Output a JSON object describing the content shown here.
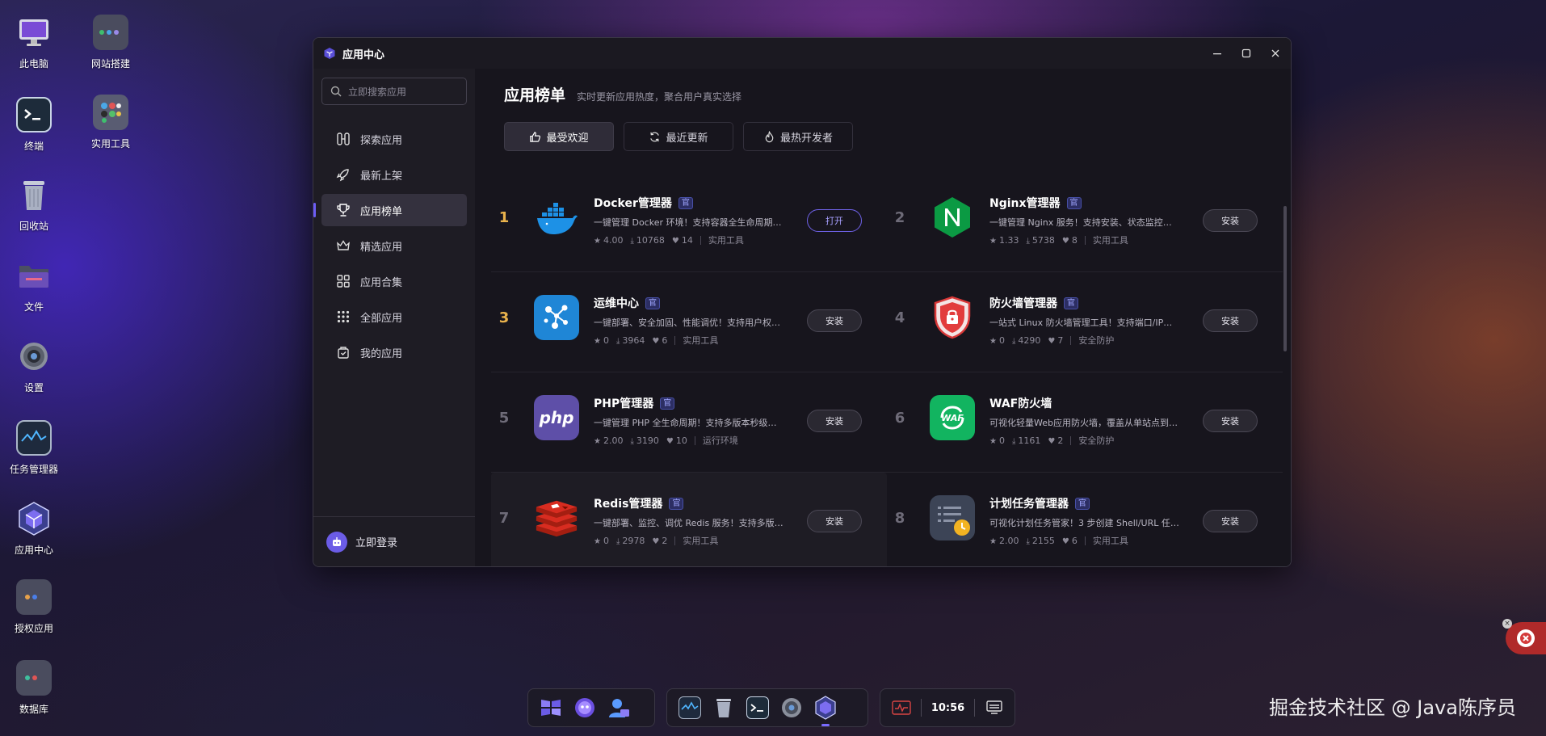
{
  "desktop": [
    {
      "label": "此电脑",
      "icon": "monitor-icon"
    },
    {
      "label": "网站搭建",
      "icon": "folder-grid-icon"
    },
    {
      "label": "终端",
      "icon": "terminal-icon"
    },
    {
      "label": "实用工具",
      "icon": "folder-grid-icon"
    },
    {
      "label": "回收站",
      "icon": "trash-icon"
    },
    {
      "label": "文件",
      "icon": "folder-icon"
    },
    {
      "label": "设置",
      "icon": "gear-icon"
    },
    {
      "label": "任务管理器",
      "icon": "activity-icon"
    },
    {
      "label": "应用中心",
      "icon": "app-center-icon"
    },
    {
      "label": "授权应用",
      "icon": "folder-grid-icon"
    },
    {
      "label": "数据库",
      "icon": "folder-grid-icon"
    }
  ],
  "window": {
    "title": "应用中心",
    "controls": [
      "minimize",
      "maximize",
      "close"
    ]
  },
  "sidebar": {
    "search_placeholder": "立即搜索应用",
    "items": [
      {
        "label": "探索应用",
        "icon": "explore-icon"
      },
      {
        "label": "最新上架",
        "icon": "rocket-icon"
      },
      {
        "label": "应用榜单",
        "icon": "trophy-icon",
        "active": true
      },
      {
        "label": "精选应用",
        "icon": "crown-icon"
      },
      {
        "label": "应用合集",
        "icon": "grid-icon"
      },
      {
        "label": "全部应用",
        "icon": "dots-grid-icon"
      },
      {
        "label": "我的应用",
        "icon": "bag-icon"
      }
    ],
    "login_label": "立即登录"
  },
  "main": {
    "title": "应用榜单",
    "subtitle": "实时更新应用热度，聚合用户真实选择",
    "tabs": [
      {
        "label": "最受欢迎",
        "icon": "thumbs-up-icon",
        "active": true
      },
      {
        "label": "最近更新",
        "icon": "refresh-icon"
      },
      {
        "label": "最热开发者",
        "icon": "flame-icon"
      }
    ],
    "official_badge": "官",
    "apps": [
      {
        "rank": "1",
        "name": "Docker管理器",
        "desc": "一键管理 Docker 环境！支持容器全生命周期…",
        "rating": "4.00",
        "downloads": "10768",
        "likes": "14",
        "category": "实用工具",
        "action": "打开",
        "icon": "docker-icon"
      },
      {
        "rank": "2",
        "name": "Nginx管理器",
        "desc": "一键管理 Nginx 服务！支持安装、状态监控…",
        "rating": "1.33",
        "downloads": "5738",
        "likes": "8",
        "category": "实用工具",
        "action": "安装",
        "icon": "nginx-icon"
      },
      {
        "rank": "3",
        "name": "运维中心",
        "desc": "一键部署、安全加固、性能调优！支持用户权…",
        "rating": "0",
        "downloads": "3964",
        "likes": "6",
        "category": "实用工具",
        "action": "安装",
        "icon": "ops-icon"
      },
      {
        "rank": "4",
        "name": "防火墙管理器",
        "desc": "一站式 Linux 防火墙管理工具！支持端口/IP…",
        "rating": "0",
        "downloads": "4290",
        "likes": "7",
        "category": "安全防护",
        "action": "安装",
        "icon": "shield-lock-icon"
      },
      {
        "rank": "5",
        "name": "PHP管理器",
        "desc": "一键管理 PHP 全生命周期！支持多版本秒级…",
        "rating": "2.00",
        "downloads": "3190",
        "likes": "10",
        "category": "运行环境",
        "action": "安装",
        "icon": "php-icon"
      },
      {
        "rank": "6",
        "name": "WAF防火墙",
        "desc": "可视化轻量Web应用防火墙，覆盖从单站点到…",
        "rating": "0",
        "downloads": "1161",
        "likes": "2",
        "category": "安全防护",
        "action": "安装",
        "icon": "waf-icon"
      },
      {
        "rank": "7",
        "name": "Redis管理器",
        "desc": "一键部署、监控、调优 Redis 服务！支持多版…",
        "rating": "0",
        "downloads": "2978",
        "likes": "2",
        "category": "实用工具",
        "action": "安装",
        "icon": "redis-icon"
      },
      {
        "rank": "8",
        "name": "计划任务管理器",
        "desc": "可视化计划任务管家！3 步创建 Shell/URL 任…",
        "rating": "2.00",
        "downloads": "2155",
        "likes": "6",
        "category": "实用工具",
        "action": "安装",
        "icon": "cron-icon"
      }
    ]
  },
  "taskbar": {
    "clock": "10:56"
  },
  "watermark": "掘金技术社区 @ Java陈序员",
  "colors": {
    "accent": "#6c5cf5",
    "rank_top": "#e9b24c",
    "window_bg": "#17151d",
    "sidebar_bg": "#1e1c24"
  }
}
